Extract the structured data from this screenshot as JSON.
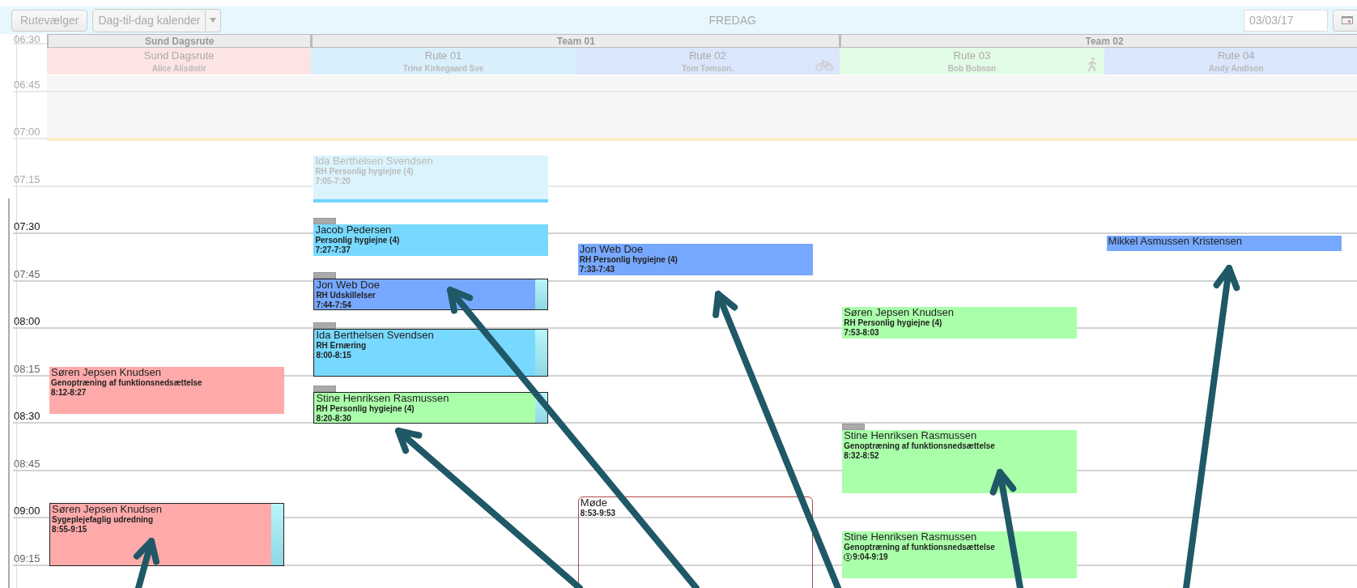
{
  "toolbar": {
    "route_button": "Rutevælger",
    "view_select": {
      "value": "Dag-til-dag kalender"
    },
    "day": "FREDAG",
    "date": {
      "value": "03/03/17"
    }
  },
  "times": [
    {
      "label": "06:30",
      "kind": "past"
    },
    {
      "label": "06:45",
      "kind": "past"
    },
    {
      "label": "07:00",
      "kind": "past"
    },
    {
      "label": "07:15",
      "kind": "past"
    },
    {
      "label": "07:30",
      "kind": "half"
    },
    {
      "label": "07:45",
      "kind": "quarter"
    },
    {
      "label": "08:00",
      "kind": "half"
    },
    {
      "label": "08:15",
      "kind": "quarter"
    },
    {
      "label": "08:30",
      "kind": "half"
    },
    {
      "label": "08:45",
      "kind": "quarter"
    },
    {
      "label": "09:00",
      "kind": "half"
    },
    {
      "label": "09:15",
      "kind": "quarter"
    }
  ],
  "groups": [
    {
      "name": "Sund Dagsrute",
      "routes": [
        {
          "name": "Sund Dagsrute",
          "driver": "Alice Alisdotir",
          "color": "#fde4e4",
          "kind": "plain",
          "events": [
            {
              "kind": "visit",
              "name": "Søren Jepsen Knudsen",
              "service": "Genoptræning af funktionsnedsættelse",
              "time": "8:12-8:27",
              "color": "#ffaaaa",
              "outlined": false,
              "side_bar": false,
              "handle": false,
              "faded": false
            },
            {
              "kind": "visit",
              "name": "Søren Jepsen Knudsen",
              "service": "Sygeplejefaglig udredning",
              "time": "8:55-9:15",
              "color": "#ffaaaa",
              "outlined": true,
              "side_bar": true,
              "handle": false,
              "faded": false
            }
          ]
        }
      ]
    },
    {
      "name": "Team 01",
      "routes": [
        {
          "name": "Rute 01",
          "driver": "Trine Kirkegaard Sve",
          "color": "#d9effc",
          "kind": "plain",
          "events": [
            {
              "kind": "visit",
              "name": "Ida Berthelsen Svendsen",
              "service": "RH Personlig hygiejne (4)",
              "time": "7:05-7:20",
              "color": "#dbf3fd",
              "outlined": false,
              "side_bar": false,
              "handle": false,
              "faded": true
            },
            {
              "kind": "visit",
              "name": "Jacob Pedersen",
              "service": "Personlig hygiejne (4)",
              "time": "7:27-7:37",
              "color": "#77d9ff",
              "outlined": false,
              "side_bar": false,
              "handle": true,
              "faded": false
            },
            {
              "kind": "visit",
              "name": "Jon Web Doe",
              "service": "RH Udskillelser",
              "time": "7:44-7:54",
              "color": "#77a8ff",
              "outlined": true,
              "side_bar": true,
              "handle": true,
              "faded": false
            },
            {
              "kind": "visit",
              "name": "Ida Berthelsen Svendsen",
              "service": "RH Ernæring",
              "time": "8:00-8:15",
              "color": "#77d9ff",
              "outlined": true,
              "side_bar": true,
              "handle": true,
              "faded": false
            },
            {
              "kind": "visit",
              "name": "Stine Henriksen Rasmussen",
              "service": "RH Personlig hygiejne (4)",
              "time": "8:20-8:30",
              "color": "#aaffaa",
              "outlined": true,
              "side_bar": true,
              "handle": true,
              "faded": false
            }
          ]
        },
        {
          "name": "Rute 02",
          "driver": "Tom Tomson.",
          "color": "#d9e6fc",
          "kind": "bike",
          "events": [
            {
              "kind": "visit",
              "name": "Jon Web Doe",
              "service": "RH Personlig hygiejne (4)",
              "time": "7:33-7:43",
              "color": "#77a8ff",
              "outlined": false,
              "side_bar": false,
              "handle": false,
              "faded": false
            },
            {
              "kind": "meeting",
              "name": "Møde",
              "time": "8:53-9:53",
              "color": "#ffffff",
              "outlined": true,
              "side_bar": false,
              "handle": false,
              "faded": false
            }
          ]
        }
      ]
    },
    {
      "name": "Team 02",
      "routes": [
        {
          "name": "Rute 03",
          "driver": "Bob Bobson",
          "color": "#e2fbe4",
          "kind": "walk",
          "events": [
            {
              "kind": "visit",
              "name": "Søren Jepsen Knudsen",
              "service": "RH Personlig hygiejne (4)",
              "time": "7:53-8:03",
              "color": "#aaffaa",
              "outlined": false,
              "side_bar": false,
              "handle": false,
              "faded": false
            },
            {
              "kind": "visit",
              "name": "Stine Henriksen Rasmussen",
              "service": "Genoptræning af funktionsnedsættelse",
              "time": "8:32-8:52",
              "color": "#aaffaa",
              "outlined": false,
              "side_bar": false,
              "handle": true,
              "faded": false
            },
            {
              "kind": "visit",
              "name": "Stine Henriksen Rasmussen",
              "service": "Genoptræning af funktionsnedsættelse",
              "badge": "1",
              "time": "9:04-9:19",
              "color": "#aaffaa",
              "outlined": false,
              "side_bar": false,
              "handle": false,
              "faded": false
            }
          ]
        },
        {
          "name": "Rute 04",
          "driver": "Andy Andison",
          "color": "#d9e6fc",
          "kind": "plain",
          "events": [
            {
              "kind": "visit",
              "name": "Mikkel Asmussen Kristensen",
              "color": "#77a8ff",
              "outlined": false,
              "side_bar": false,
              "handle": false,
              "faded": false
            }
          ]
        }
      ]
    }
  ]
}
